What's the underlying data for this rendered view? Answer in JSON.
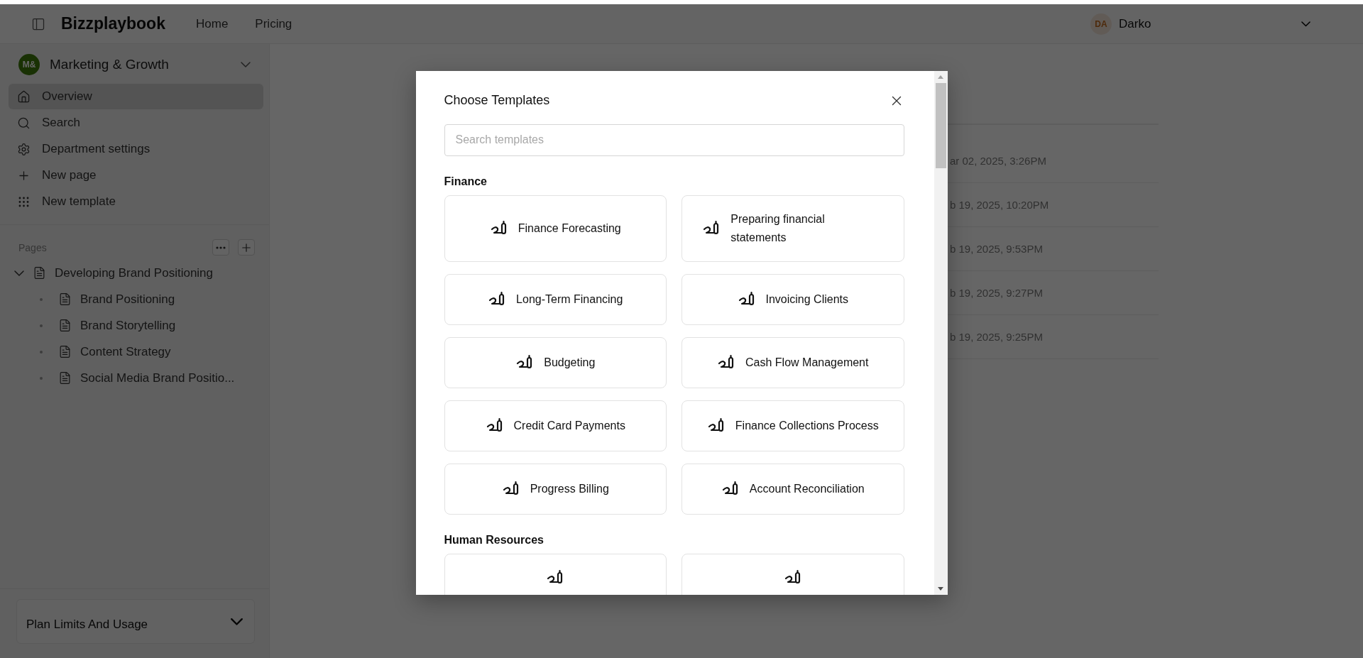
{
  "header": {
    "brand": "Bizzplaybook",
    "nav": [
      "Home",
      "Pricing"
    ],
    "user": {
      "initials": "DA",
      "name": "Darko"
    }
  },
  "sidebar": {
    "workspace": {
      "initials": "M&",
      "name": "Marketing & Growth"
    },
    "nav": [
      {
        "kind": "home",
        "label": "Overview",
        "selected": true
      },
      {
        "kind": "search",
        "label": "Search",
        "selected": false
      },
      {
        "kind": "settings",
        "label": "Department settings",
        "selected": false
      },
      {
        "kind": "plus",
        "label": "New page",
        "selected": false
      },
      {
        "kind": "grid",
        "label": "New template",
        "selected": false
      }
    ],
    "pages": {
      "label": "Pages",
      "tree": [
        {
          "title": "Developing Brand Positioning",
          "expanded": true,
          "children": [
            {
              "title": "Brand Positioning"
            },
            {
              "title": "Brand Storytelling"
            },
            {
              "title": "Content Strategy"
            },
            {
              "title": "Social Media Brand Positio..."
            }
          ]
        }
      ]
    },
    "plan": {
      "label": "Plan Limits And Usage"
    }
  },
  "background_table": {
    "rows": [
      "ar 02, 2025, 3:26PM",
      "b 19, 2025, 10:20PM",
      "b 19, 2025, 9:53PM",
      "b 19, 2025, 9:27PM",
      "b 19, 2025, 9:25PM"
    ]
  },
  "modal": {
    "title": "Choose Templates",
    "search": {
      "placeholder": "Search templates"
    },
    "sections": [
      {
        "title": "Finance",
        "templates": [
          {
            "kind": "full",
            "title": "Finance Forecasting"
          },
          {
            "kind": "full",
            "title": "Preparing financial statements"
          },
          {
            "kind": "full",
            "title": "Long-Term Financing"
          },
          {
            "kind": "full",
            "title": "Invoicing Clients"
          },
          {
            "kind": "full",
            "title": "Budgeting"
          },
          {
            "kind": "full",
            "title": "Cash Flow Management"
          },
          {
            "kind": "full",
            "title": "Credit Card Payments"
          },
          {
            "kind": "full",
            "title": "Finance Collections Process"
          },
          {
            "kind": "full",
            "title": "Progress Billing"
          },
          {
            "kind": "full",
            "title": "Account Reconciliation"
          }
        ]
      },
      {
        "title": "Human Resources",
        "templates": [
          {
            "kind": "partial"
          },
          {
            "kind": "partial"
          }
        ]
      }
    ]
  }
}
